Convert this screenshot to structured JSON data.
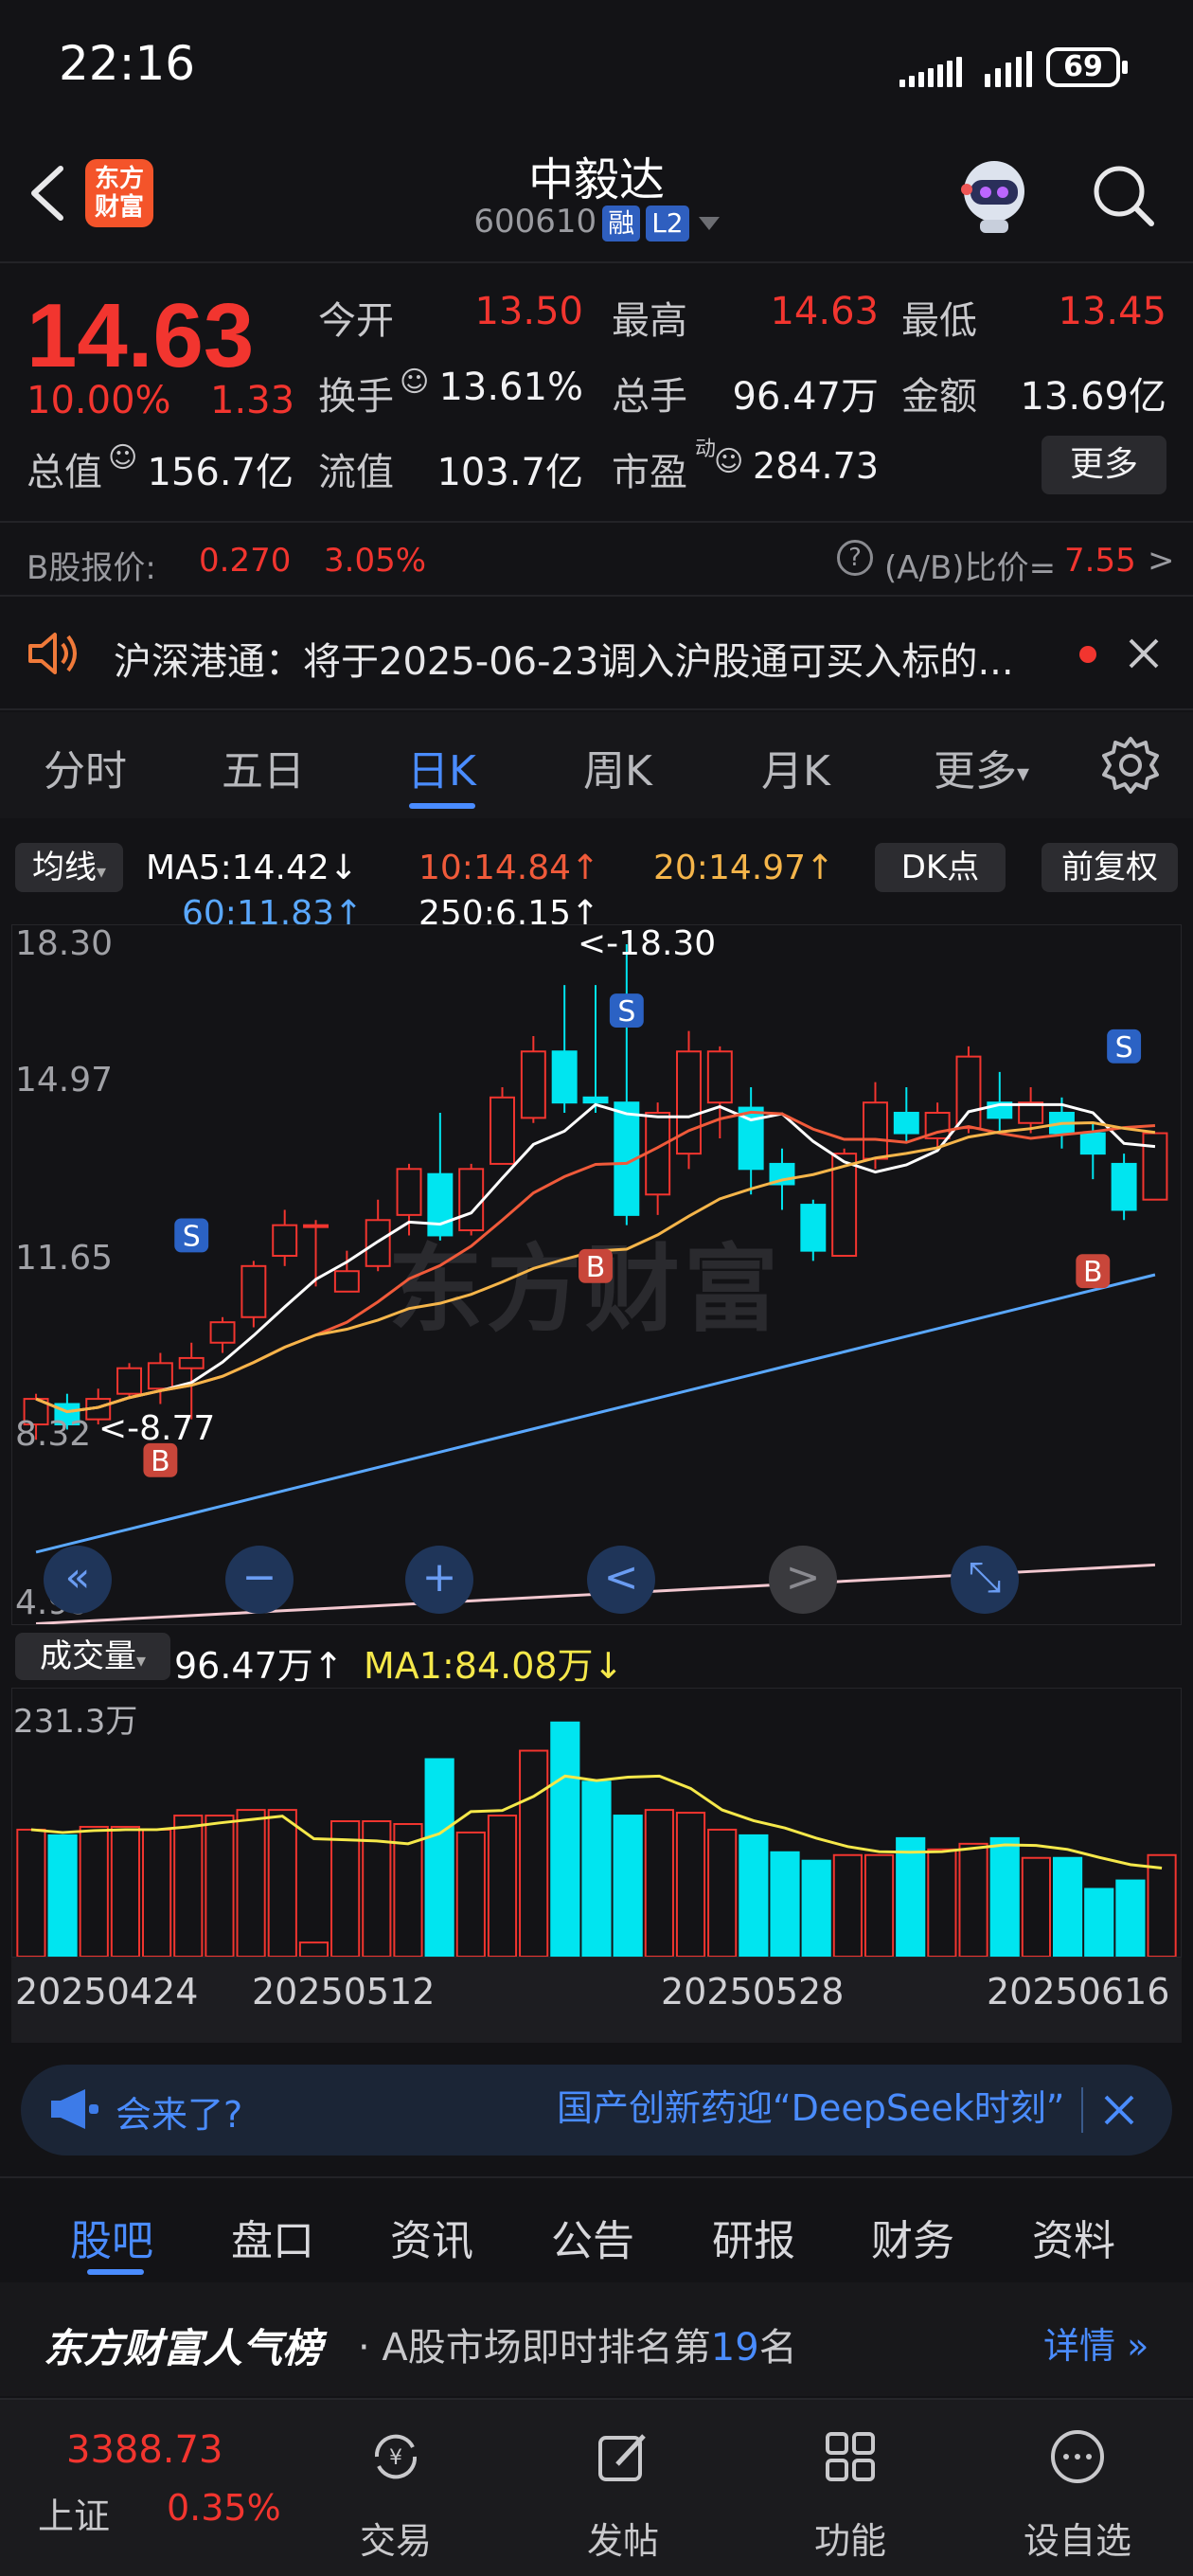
{
  "status_bar": {
    "time": "22:16",
    "battery": "69"
  },
  "header": {
    "logo_text": "东方\n财富",
    "stock_name": "中毅达",
    "stock_code": "600610",
    "tags": [
      "融",
      "L2"
    ]
  },
  "quote": {
    "price": "14.63",
    "change_pct": "10.00%",
    "change": "1.33",
    "fields": [
      {
        "label": "今开",
        "value": "13.50",
        "color": "#f2352f"
      },
      {
        "label": "最高",
        "value": "14.63",
        "color": "#f2352f"
      },
      {
        "label": "最低",
        "value": "13.45",
        "color": "#f2352f"
      },
      {
        "label": "换手",
        "value": "13.61%",
        "color": "#f2f2f4"
      },
      {
        "label": "总手",
        "value": "96.47万",
        "color": "#f2f2f4"
      },
      {
        "label": "金额",
        "value": "13.69亿",
        "color": "#f2f2f4"
      },
      {
        "label": "总值",
        "value": "156.7亿",
        "color": "#f2f2f4"
      },
      {
        "label": "流值",
        "value": "103.7亿",
        "color": "#f2f2f4"
      },
      {
        "label": "市盈",
        "value": "284.73",
        "color": "#f2f2f4"
      }
    ],
    "pe_superscript": "动",
    "more_label": "更多"
  },
  "b_share": {
    "label": "B股报价:",
    "price": "0.270",
    "pct": "3.05%",
    "ratio_label": "(A/B)比价=",
    "ratio": "7.55",
    "arrow": ">"
  },
  "notice": {
    "text": "沪深港通：将于2025-06-23调入沪股通可买入标的..."
  },
  "k_tabs": [
    "分时",
    "五日",
    "日K",
    "周K",
    "月K",
    "更多"
  ],
  "k_tab_active": 2,
  "ma_legend": {
    "selector": "均线",
    "ma5": "MA5:14.42↓",
    "ma10": "10:14.84↑",
    "ma20": "20:14.97↑",
    "ma60": "60:11.83↑",
    "ma250": "250:6.15↑",
    "dk_button": "DK点",
    "adjust_button": "前复权"
  },
  "colors": {
    "up": "#f2352f",
    "down": "#00e5f0",
    "ma5": "#ffffff",
    "ma10": "#f05a3a",
    "ma20": "#f5b54a",
    "ma60": "#5aa8ff",
    "ma250": "#f3c8d0",
    "accent": "#4a8cff"
  },
  "k_chart": {
    "y_labels": [
      "18.30",
      "14.97",
      "11.65",
      "8.32",
      "4.99"
    ],
    "high_label": "<-18.30",
    "low_label": "<-8.77",
    "watermark": "东方财富",
    "markers": [
      "S",
      "S",
      "S",
      "B",
      "B",
      "B"
    ]
  },
  "chart_data": {
    "type": "candlestick",
    "ylim": [
      4.99,
      18.3
    ],
    "x_ticks": [
      "20250424",
      "20250512",
      "20250528",
      "20250616"
    ],
    "candles": [
      {
        "o": 8.9,
        "c": 9.4,
        "h": 9.5,
        "l": 8.6
      },
      {
        "o": 9.3,
        "c": 8.9,
        "h": 9.5,
        "l": 8.8
      },
      {
        "o": 9.0,
        "c": 9.4,
        "h": 9.6,
        "l": 8.9
      },
      {
        "o": 9.5,
        "c": 10.0,
        "h": 10.1,
        "l": 9.4
      },
      {
        "o": 9.6,
        "c": 10.1,
        "h": 10.3,
        "l": 9.3
      },
      {
        "o": 10.0,
        "c": 10.2,
        "h": 10.5,
        "l": 9.0
      },
      {
        "o": 10.5,
        "c": 10.9,
        "h": 11.0,
        "l": 10.3
      },
      {
        "o": 11.0,
        "c": 12.0,
        "h": 12.1,
        "l": 10.8
      },
      {
        "o": 12.2,
        "c": 12.8,
        "h": 13.1,
        "l": 12.0
      },
      {
        "o": 12.8,
        "c": 12.8,
        "h": 12.9,
        "l": 11.6
      },
      {
        "o": 11.5,
        "c": 11.9,
        "h": 12.3,
        "l": 11.5
      },
      {
        "o": 12.0,
        "c": 12.9,
        "h": 13.3,
        "l": 11.9
      },
      {
        "o": 13.0,
        "c": 13.9,
        "h": 14.0,
        "l": 12.6
      },
      {
        "o": 13.8,
        "c": 12.6,
        "h": 15.0,
        "l": 12.5
      },
      {
        "o": 12.7,
        "c": 13.9,
        "h": 14.0,
        "l": 12.6
      },
      {
        "o": 14.0,
        "c": 15.3,
        "h": 15.5,
        "l": 14.0
      },
      {
        "o": 14.9,
        "c": 16.2,
        "h": 16.5,
        "l": 14.8
      },
      {
        "o": 16.2,
        "c": 15.2,
        "h": 17.5,
        "l": 15.0
      },
      {
        "o": 15.3,
        "c": 15.2,
        "h": 17.5,
        "l": 15.0
      },
      {
        "o": 15.2,
        "c": 13.0,
        "h": 18.3,
        "l": 12.8
      },
      {
        "o": 13.4,
        "c": 15.0,
        "h": 15.2,
        "l": 13.0
      },
      {
        "o": 14.2,
        "c": 16.2,
        "h": 16.6,
        "l": 13.9
      },
      {
        "o": 15.2,
        "c": 16.2,
        "h": 16.3,
        "l": 14.5
      },
      {
        "o": 15.1,
        "c": 13.9,
        "h": 15.5,
        "l": 13.4
      },
      {
        "o": 14.0,
        "c": 13.6,
        "h": 14.3,
        "l": 13.1
      },
      {
        "o": 13.2,
        "c": 12.3,
        "h": 13.3,
        "l": 12.1
      },
      {
        "o": 12.2,
        "c": 14.2,
        "h": 14.3,
        "l": 12.2
      },
      {
        "o": 14.1,
        "c": 15.2,
        "h": 15.6,
        "l": 13.9
      },
      {
        "o": 15.0,
        "c": 14.6,
        "h": 15.5,
        "l": 14.4
      },
      {
        "o": 14.5,
        "c": 15.0,
        "h": 15.2,
        "l": 14.3
      },
      {
        "o": 14.7,
        "c": 16.1,
        "h": 16.3,
        "l": 14.6
      },
      {
        "o": 15.2,
        "c": 14.9,
        "h": 15.8,
        "l": 14.6
      },
      {
        "o": 14.8,
        "c": 15.2,
        "h": 15.5,
        "l": 14.6
      },
      {
        "o": 15.0,
        "c": 14.6,
        "h": 15.3,
        "l": 14.3
      },
      {
        "o": 14.6,
        "c": 14.2,
        "h": 14.8,
        "l": 13.7
      },
      {
        "o": 14.0,
        "c": 13.1,
        "h": 14.2,
        "l": 12.9
      },
      {
        "o": 13.3,
        "c": 14.6,
        "h": 14.6,
        "l": 13.3
      }
    ]
  },
  "controls": [
    "«",
    "−",
    "+",
    "<",
    ">",
    "⤡"
  ],
  "volume": {
    "selector": "成交量",
    "value": "96.47万↑",
    "ma1": "MA1:84.08万↓",
    "max_label": "231.3万"
  },
  "banner": {
    "left_text": "会来了?",
    "right_text": "国产创新药迎“DeepSeek时刻”"
  },
  "bottom_tabs": [
    "股吧",
    "盘口",
    "资讯",
    "公告",
    "研报",
    "财务",
    "资料"
  ],
  "rank": {
    "title": "东方财富人气榜",
    "text_pre": "· A股市场即时排名第",
    "rank_num": "19",
    "text_post": "名",
    "detail": "详情"
  },
  "nav": {
    "index_value": "3388.73",
    "index_name": "上证",
    "index_pct": "0.35%",
    "items": [
      "交易",
      "发帖",
      "功能",
      "设自选"
    ]
  }
}
